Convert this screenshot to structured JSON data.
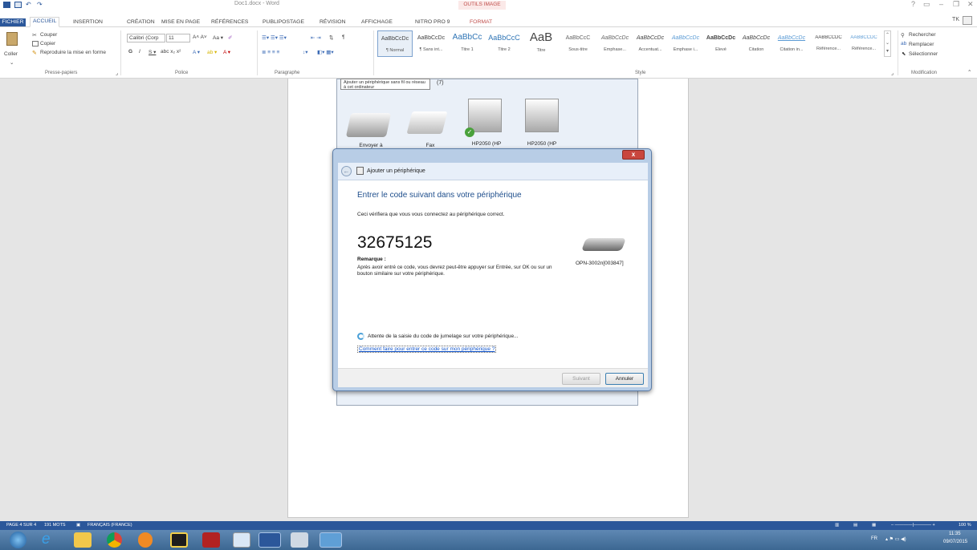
{
  "window": {
    "doc_title": "Doc1.docx - Word",
    "tools_label": "OUTILS IMAGE",
    "help": "?",
    "user": "TK"
  },
  "tabs": [
    {
      "label": "FICHIER"
    },
    {
      "label": "ACCUEIL"
    },
    {
      "label": "INSERTION"
    },
    {
      "label": "CRÉATION"
    },
    {
      "label": "MISE EN PAGE"
    },
    {
      "label": "RÉFÉRENCES"
    },
    {
      "label": "PUBLIPOSTAGE"
    },
    {
      "label": "RÉVISION"
    },
    {
      "label": "AFFICHAGE"
    },
    {
      "label": "NITRO PRO 9"
    },
    {
      "label": "FORMAT"
    }
  ],
  "clipboard": {
    "paste": "Coller",
    "cut": "Couper",
    "copy": "Copier",
    "format_painter": "Reproduire la mise en forme",
    "group": "Presse-papiers"
  },
  "font": {
    "name": "Calibri (Corp",
    "size": "11",
    "group": "Police"
  },
  "paragraph": {
    "group": "Paragraphe"
  },
  "styles": {
    "group": "Style",
    "items": [
      {
        "sample": "AaBbCcDc",
        "name": "¶ Normal"
      },
      {
        "sample": "AaBbCcDc",
        "name": "¶ Sans int..."
      },
      {
        "sample": "AaBbCc",
        "name": "Titre 1"
      },
      {
        "sample": "AaBbCcC",
        "name": "Titre 2"
      },
      {
        "sample": "AaB",
        "name": "Titre"
      },
      {
        "sample": "AaBbCcC",
        "name": "Sous-titre"
      },
      {
        "sample": "AaBbCcDc",
        "name": "Emphase..."
      },
      {
        "sample": "AaBbCcDc",
        "name": "Accentuat..."
      },
      {
        "sample": "AaBbCcDc",
        "name": "Emphase i..."
      },
      {
        "sample": "AaBbCcDc",
        "name": "Élevé"
      },
      {
        "sample": "AaBbCcDc",
        "name": "Citation"
      },
      {
        "sample": "AaBbCcDc",
        "name": "Citation in..."
      },
      {
        "sample": "AABBCCDC",
        "name": "Référence..."
      },
      {
        "sample": "AABBCCDC",
        "name": "Référence..."
      }
    ]
  },
  "editing": {
    "find": "Rechercher",
    "replace": "Remplacer",
    "select": "Sélectionner",
    "group": "Modification"
  },
  "embed": {
    "tooltip": "Ajouter un périphérique sans fil ou réseau à cet ordinateur",
    "count": "(7)",
    "devices": [
      {
        "label": "Envoyer à"
      },
      {
        "label": "Fax"
      },
      {
        "label": "HP2050 (HP"
      },
      {
        "label": "HP2050 (HP"
      }
    ]
  },
  "dialog": {
    "title": "Ajouter un périphérique",
    "close": "x",
    "heading": "Entrer le code suivant dans votre périphérique",
    "subtext": "Ceci vérifiera que vous vous connectez au périphérique correct.",
    "code": "32675125",
    "remark_label": "Remarque :",
    "remark": "Après avoir entré ce code, vous devrez peut-être appuyer sur Entrée, sur OK ou sur un bouton similaire sur votre périphérique.",
    "device_name": "OPN-3002n[003847]",
    "waiting": "Attente de la saisie du code de jumelage sur votre périphérique...",
    "help_link": "Comment faire pour entrer ce code sur mon périphérique ?",
    "next": "Suivant",
    "cancel": "Annuler"
  },
  "statusbar": {
    "page": "PAGE 4 SUR 4",
    "words": "191 MOTS",
    "language": "FRANÇAIS (FRANCE)",
    "zoom": "100 %"
  },
  "taskbar": {
    "lang": "FR",
    "time": "11:35",
    "date": "09/07/2015"
  }
}
